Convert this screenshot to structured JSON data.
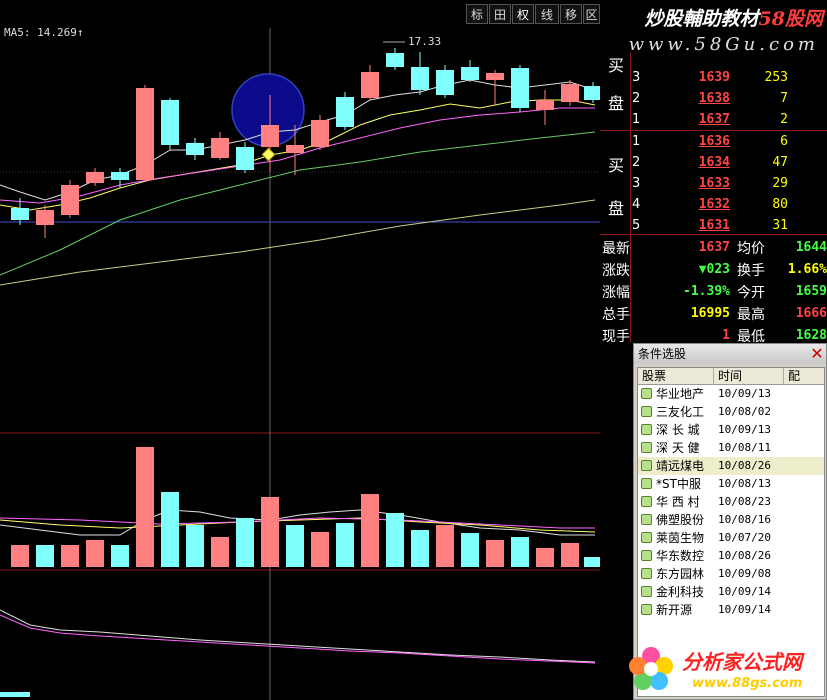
{
  "toolbar": {
    "buttons": [
      "标",
      "田",
      "权",
      "线",
      "移",
      "区"
    ]
  },
  "watermark_top": {
    "line1_prefix": "炒股輔助教材",
    "line1_brand": "58股网",
    "line2": "www.58Gu.com"
  },
  "ma_label": "MA5: 14.269↑",
  "peak_label": "17.33",
  "sell_orders": [
    {
      "level": "",
      "price": "",
      "volume": ""
    },
    {
      "level": "3",
      "price": "1639",
      "volume": "253"
    },
    {
      "level": "2",
      "price": "1638",
      "volume": "7"
    },
    {
      "level": "1",
      "price": "1637",
      "volume": "2"
    }
  ],
  "buy_orders": [
    {
      "level": "1",
      "price": "1636",
      "volume": "6"
    },
    {
      "level": "2",
      "price": "1634",
      "volume": "47"
    },
    {
      "level": "3",
      "price": "1633",
      "volume": "29"
    },
    {
      "level": "4",
      "price": "1632",
      "volume": "80"
    },
    {
      "level": "5",
      "price": "1631",
      "volume": "31"
    }
  ],
  "sell_label": [
    "买",
    "盘"
  ],
  "buy_label": [
    "买",
    "盘"
  ],
  "quote_info": [
    {
      "label": "最新",
      "value": "1637",
      "label2": "均价",
      "value2": "1644"
    },
    {
      "label": "涨跌",
      "value": "▼023",
      "label2": "换手",
      "value2": "1.66%"
    },
    {
      "label": "涨幅",
      "value": "-1.39%",
      "label2": "今开",
      "value2": "1659"
    },
    {
      "label": "总手",
      "value": "16995",
      "label2": "最高",
      "value2": "1666"
    },
    {
      "label": "现手",
      "value": "1",
      "label2": "最低",
      "value2": "1628"
    }
  ],
  "stock_selector": {
    "title": "条件选股",
    "close": "✕",
    "columns": [
      "股票",
      "时间",
      "配"
    ],
    "rows": [
      {
        "name": "华业地产",
        "date": "10/09/13"
      },
      {
        "name": "三友化工",
        "date": "10/08/02"
      },
      {
        "name": "深 长 城",
        "date": "10/09/13"
      },
      {
        "name": "深 天 健",
        "date": "10/08/11"
      },
      {
        "name": "靖远煤电",
        "date": "10/08/26"
      },
      {
        "name": "*ST中服",
        "date": "10/08/13"
      },
      {
        "name": "华 西 村",
        "date": "10/08/23"
      },
      {
        "name": "佛塑股份",
        "date": "10/08/16"
      },
      {
        "name": "莱茵生物",
        "date": "10/07/20"
      },
      {
        "name": "华东数控",
        "date": "10/08/26"
      },
      {
        "name": "东方园林",
        "date": "10/09/08"
      },
      {
        "name": "金利科技",
        "date": "10/09/14"
      },
      {
        "name": "新开源",
        "date": "10/09/14"
      }
    ]
  },
  "watermark_bottom": {
    "brand": "分析家公式网",
    "url": "www.88gs.com"
  },
  "colors": {
    "up": "#ff8080",
    "down": "#80ffff",
    "accent_red": "#ff4444",
    "accent_yellow": "#ffff00"
  }
}
